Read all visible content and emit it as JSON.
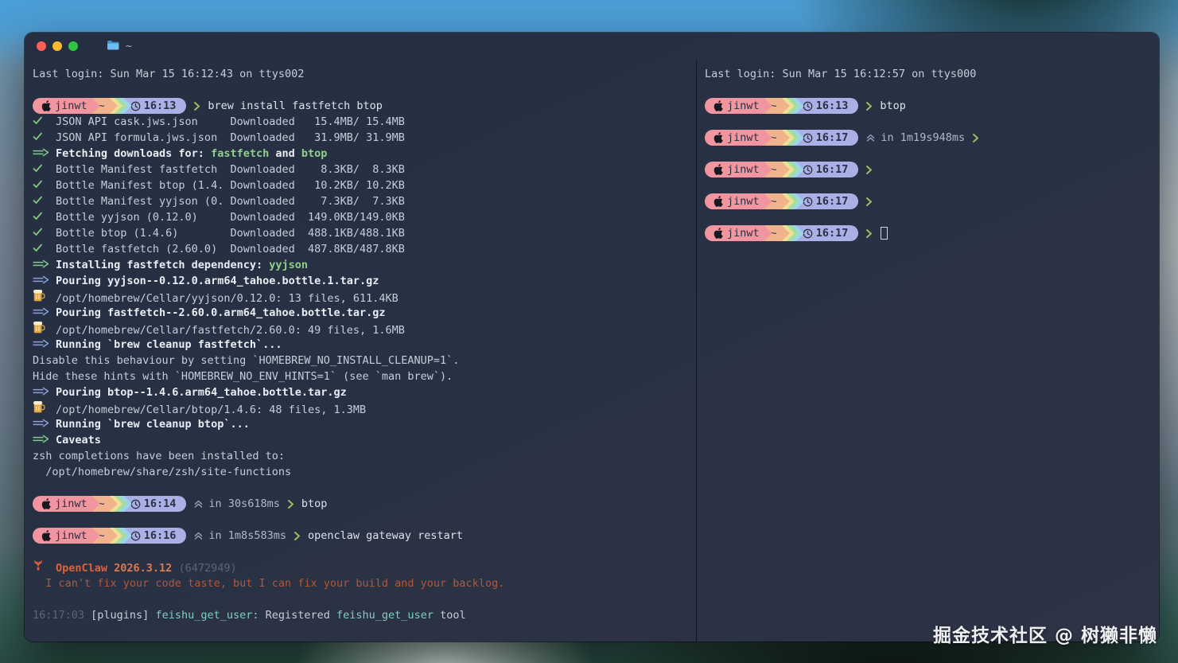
{
  "window": {
    "title": "~"
  },
  "watermark": "掘金技术社区 @ 树獭非懒",
  "colors": {
    "terminal_bg": "#273142",
    "accent_green": "#8fd08a",
    "accent_blue": "#8b9fd8",
    "prompt_pink": "#f195a0",
    "prompt_peach": "#f1b38e",
    "prompt_yellow": "#f2df96",
    "prompt_green": "#a5dfa0",
    "prompt_blue": "#9cd4ec",
    "prompt_lavender": "#a9b0e6",
    "openclaw_orange": "#e2603a",
    "teal": "#7fcfc0"
  },
  "left_pane": {
    "lines": [
      {
        "s": [
          [
            "Last login: Sun Mar 15 16:12:43 on ttys002",
            "fg"
          ]
        ]
      },
      {
        "blank": true
      },
      {
        "p": {
          "user": "jinwt",
          "dir": "~",
          "time": "16:13",
          "cmd": "brew install fastfetch btop"
        }
      },
      {
        "s": [
          {
            "i": "check-icon"
          },
          [
            "JSON API cask.jws.json     Downloaded   15.4MB/ 15.4MB",
            "fg"
          ]
        ]
      },
      {
        "s": [
          {
            "i": "check-icon"
          },
          [
            "JSON API formula.jws.json  Downloaded   31.9MB/ 31.9MB",
            "fg"
          ]
        ]
      },
      {
        "s": [
          {
            "i": "arrow-green-icon"
          },
          [
            "Fetching downloads for: ",
            "bold"
          ],
          [
            "fastfetch",
            "greenBold"
          ],
          [
            " and ",
            "bold"
          ],
          [
            "btop",
            "greenBold"
          ]
        ]
      },
      {
        "s": [
          {
            "i": "check-icon"
          },
          [
            "Bottle Manifest fastfetch  Downloaded    8.3KB/  8.3KB",
            "fg"
          ]
        ]
      },
      {
        "s": [
          {
            "i": "check-icon"
          },
          [
            "Bottle Manifest btop (1.4. Downloaded   10.2KB/ 10.2KB",
            "fg"
          ]
        ]
      },
      {
        "s": [
          {
            "i": "check-icon"
          },
          [
            "Bottle Manifest yyjson (0. Downloaded    7.3KB/  7.3KB",
            "fg"
          ]
        ]
      },
      {
        "s": [
          {
            "i": "check-icon"
          },
          [
            "Bottle yyjson (0.12.0)     Downloaded  149.0KB/149.0KB",
            "fg"
          ]
        ]
      },
      {
        "s": [
          {
            "i": "check-icon"
          },
          [
            "Bottle btop (1.4.6)        Downloaded  488.1KB/488.1KB",
            "fg"
          ]
        ]
      },
      {
        "s": [
          {
            "i": "check-icon"
          },
          [
            "Bottle fastfetch (2.60.0)  Downloaded  487.8KB/487.8KB",
            "fg"
          ]
        ]
      },
      {
        "s": [
          {
            "i": "arrow-green-icon"
          },
          [
            "Installing fastfetch dependency: ",
            "bold"
          ],
          [
            "yyjson",
            "greenBold"
          ]
        ]
      },
      {
        "s": [
          {
            "i": "arrow-blue-icon"
          },
          [
            "Pouring yyjson--0.12.0.arm64_tahoe.bottle.1.tar.gz",
            "bold"
          ]
        ]
      },
      {
        "s": [
          {
            "i": "beer-icon"
          },
          [
            "/opt/homebrew/Cellar/yyjson/0.12.0: 13 files, 611.4KB",
            "fg"
          ]
        ]
      },
      {
        "s": [
          {
            "i": "arrow-blue-icon"
          },
          [
            "Pouring fastfetch--2.60.0.arm64_tahoe.bottle.tar.gz",
            "bold"
          ]
        ]
      },
      {
        "s": [
          {
            "i": "beer-icon"
          },
          [
            "/opt/homebrew/Cellar/fastfetch/2.60.0: 49 files, 1.6MB",
            "fg"
          ]
        ]
      },
      {
        "s": [
          {
            "i": "arrow-blue-icon"
          },
          [
            "Running `brew cleanup fastfetch`...",
            "bold"
          ]
        ]
      },
      {
        "s": [
          [
            "Disable this behaviour by setting `HOMEBREW_NO_INSTALL_CLEANUP=1`.",
            "fg"
          ]
        ]
      },
      {
        "s": [
          [
            "Hide these hints with `HOMEBREW_NO_ENV_HINTS=1` (see `man brew`).",
            "fg"
          ]
        ]
      },
      {
        "s": [
          {
            "i": "arrow-blue-icon"
          },
          [
            "Pouring btop--1.4.6.arm64_tahoe.bottle.tar.gz",
            "bold"
          ]
        ]
      },
      {
        "s": [
          {
            "i": "beer-icon"
          },
          [
            "/opt/homebrew/Cellar/btop/1.4.6: 48 files, 1.3MB",
            "fg"
          ]
        ]
      },
      {
        "s": [
          {
            "i": "arrow-blue-icon"
          },
          [
            "Running `brew cleanup btop`...",
            "bold"
          ]
        ]
      },
      {
        "s": [
          {
            "i": "arrow-green-icon"
          },
          [
            "Caveats",
            "bold"
          ]
        ]
      },
      {
        "s": [
          [
            "zsh completions have been installed to:",
            "fg"
          ]
        ]
      },
      {
        "s": [
          [
            "  /opt/homebrew/share/zsh/site-functions",
            "fg"
          ]
        ]
      },
      {
        "blank": true
      },
      {
        "p": {
          "user": "jinwt",
          "dir": "~",
          "time": "16:14",
          "dur": "in 30s618ms",
          "cmd": "btop"
        }
      },
      {
        "blank": true
      },
      {
        "p": {
          "user": "jinwt",
          "dir": "~",
          "time": "16:16",
          "dur": "in 1m8s583ms",
          "cmd": "openclaw gateway restart"
        }
      },
      {
        "blank": true
      },
      {
        "s": [
          {
            "i": "lobster-icon"
          },
          [
            "OpenClaw ",
            "claw"
          ],
          [
            "2026.3.12 ",
            "ver"
          ],
          [
            "(6472949)",
            "dim"
          ]
        ]
      },
      {
        "s": [
          [
            "  I can't fix your code taste, but I can fix your build and your backlog.",
            "rust"
          ]
        ]
      },
      {
        "blank": true
      },
      {
        "s": [
          [
            "16:17:03 ",
            "dim"
          ],
          [
            "[plugins] ",
            "fg"
          ],
          [
            "feishu_get_user:",
            "teal"
          ],
          [
            " Registered ",
            "fg"
          ],
          [
            "feishu_get_user",
            "teal"
          ],
          [
            " tool",
            "fg"
          ]
        ]
      }
    ]
  },
  "right_pane": {
    "lines": [
      {
        "s": [
          [
            "Last login: Sun Mar 15 16:12:57 on ttys000",
            "fg"
          ]
        ]
      },
      {
        "blank": true
      },
      {
        "p": {
          "user": "jinwt",
          "dir": "~",
          "time": "16:13",
          "cmd": "btop"
        }
      },
      {
        "blank": true
      },
      {
        "p": {
          "user": "jinwt",
          "dir": "~",
          "time": "16:17",
          "dur": "in 1m19s948ms"
        }
      },
      {
        "blank": true
      },
      {
        "p": {
          "user": "jinwt",
          "dir": "~",
          "time": "16:17"
        }
      },
      {
        "blank": true
      },
      {
        "p": {
          "user": "jinwt",
          "dir": "~",
          "time": "16:17"
        }
      },
      {
        "blank": true
      },
      {
        "p": {
          "user": "jinwt",
          "dir": "~",
          "time": "16:17",
          "cursor": true
        }
      }
    ]
  }
}
